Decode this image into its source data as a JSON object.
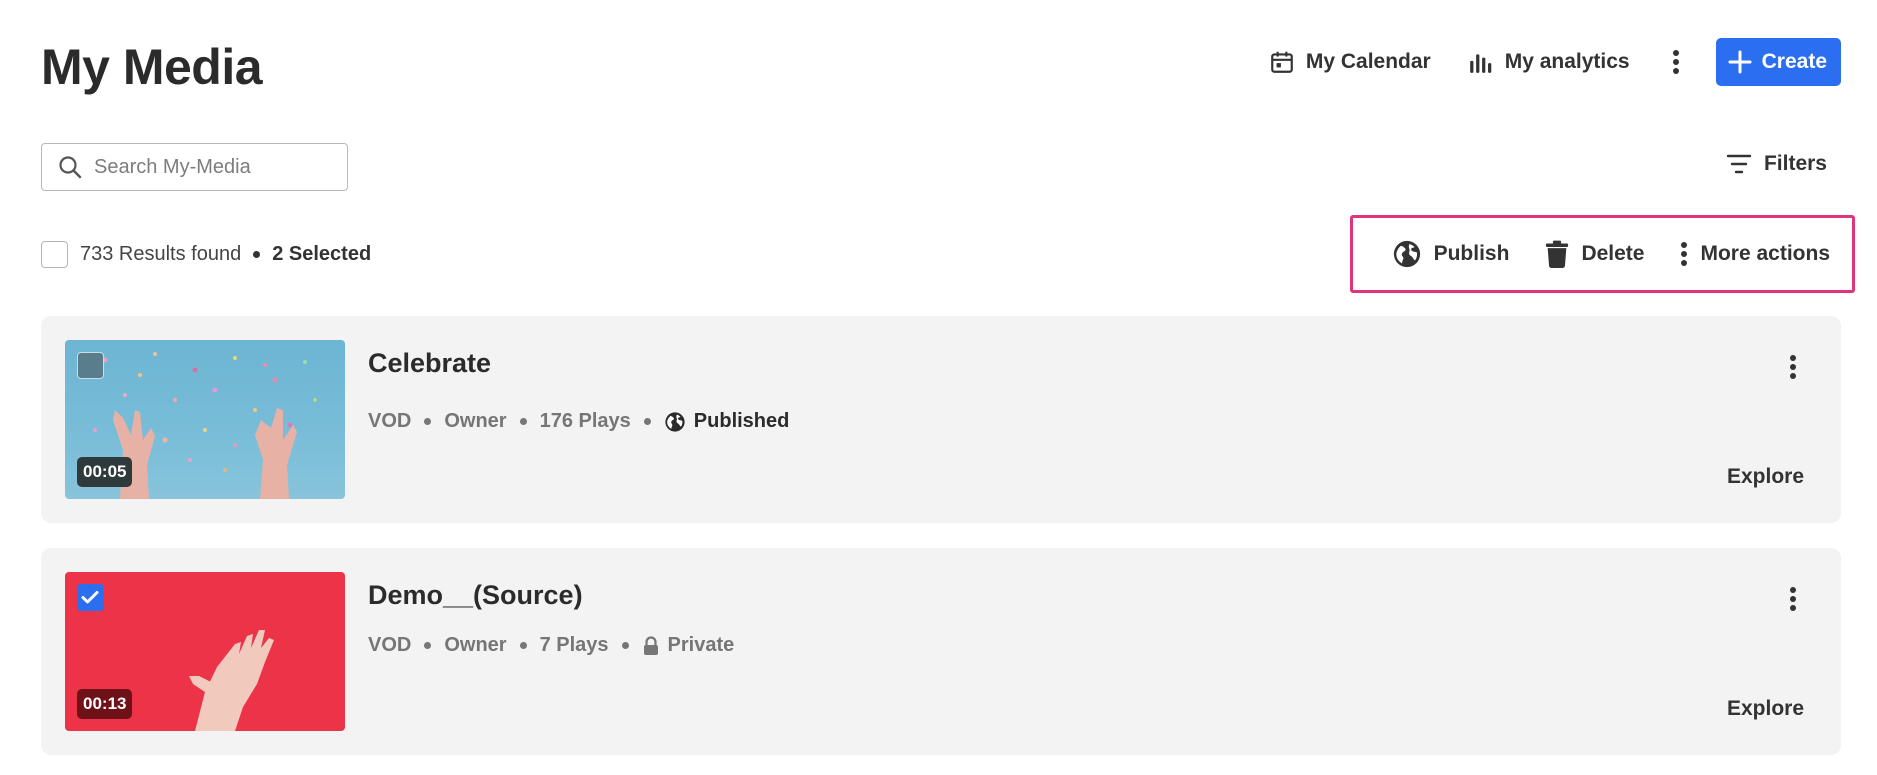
{
  "header": {
    "title": "My Media",
    "calendar_label": "My Calendar",
    "analytics_label": "My analytics",
    "create_label": "Create"
  },
  "search": {
    "placeholder": "Search My-Media",
    "value": ""
  },
  "filters_label": "Filters",
  "results": {
    "count_text": "733 Results found",
    "selected_text": "2 Selected"
  },
  "bulk_actions": {
    "publish_label": "Publish",
    "delete_label": "Delete",
    "more_label": "More actions"
  },
  "media": [
    {
      "title": "Celebrate",
      "duration": "00:05",
      "type": "VOD",
      "role": "Owner",
      "plays": "176 Plays",
      "status": "Published",
      "status_icon": "globe-icon",
      "checked": false,
      "explore_label": "Explore"
    },
    {
      "title": "Demo__(Source)",
      "duration": "00:13",
      "type": "VOD",
      "role": "Owner",
      "plays": "7 Plays",
      "status": "Private",
      "status_icon": "lock-icon",
      "checked": true,
      "explore_label": "Explore"
    }
  ],
  "colors": {
    "accent": "#2b6ff0",
    "highlight_border": "#e0357b",
    "card_bg": "#f3f3f3",
    "thumb1_bg": "#6fb6d3",
    "thumb2_bg": "#ec3348"
  }
}
